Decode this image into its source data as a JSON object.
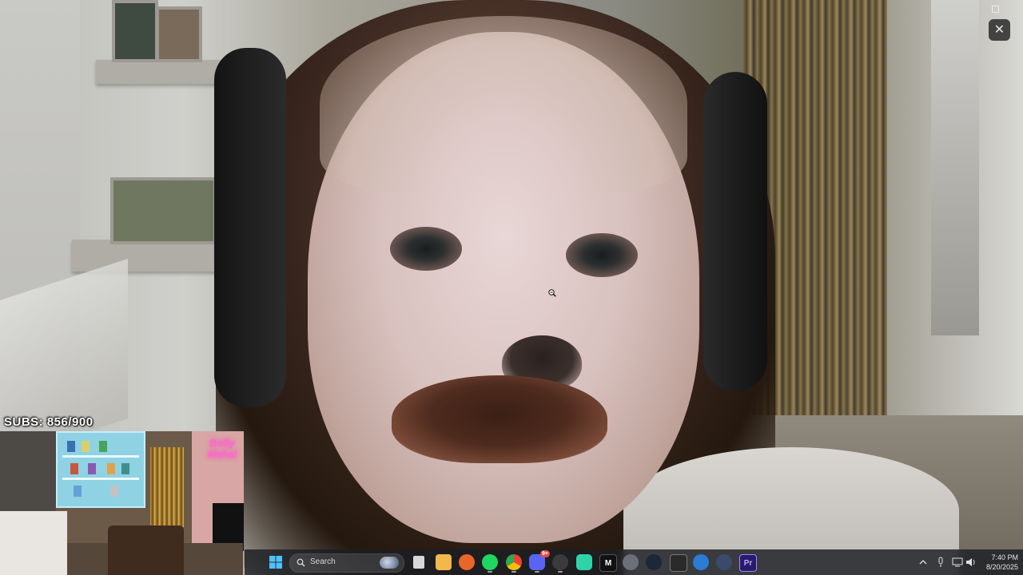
{
  "overlay": {
    "subs_counter": "SUBS: 856/900",
    "neon_sign": "Dolly Mahal"
  },
  "window": {
    "close_glyph": "✕"
  },
  "taskbar": {
    "search_label": "Search",
    "pinned_apps": [
      {
        "name": "file-explorer-icon",
        "color": "#f2b84b"
      },
      {
        "name": "firefox-icon",
        "color": "#e8662a"
      },
      {
        "name": "spotify-icon",
        "color": "#1ed760"
      },
      {
        "name": "chrome-icon",
        "color": "#4285f4"
      },
      {
        "name": "discord-icon",
        "color": "#5865f2"
      },
      {
        "name": "obs-icon",
        "color": "#3b3b3b"
      },
      {
        "name": "chat-app-icon",
        "color": "#2fd3a8"
      },
      {
        "name": "streamer-app-icon",
        "color": "#111111"
      },
      {
        "name": "app-icon",
        "color": "#6b6f7a"
      },
      {
        "name": "steam-icon",
        "color": "#1b2838"
      },
      {
        "name": "elgato-icon",
        "color": "#2a2a2a"
      },
      {
        "name": "edge-app-icon",
        "color": "#2b7cd3"
      },
      {
        "name": "vpn-icon",
        "color": "#3b4a6b"
      },
      {
        "name": "premiere-pro-icon",
        "color": "#2a1a6a"
      }
    ],
    "premiere_label": "Pr",
    "streamer_label": "M",
    "discord_badge": "9+",
    "clock": {
      "time": "7:40 PM",
      "date": "8/20/2025"
    }
  },
  "colors": {
    "windows_blue": "#4cc2ff",
    "taskbar_bg": "#1c1e24",
    "neon_pink": "#ff6ad0"
  }
}
